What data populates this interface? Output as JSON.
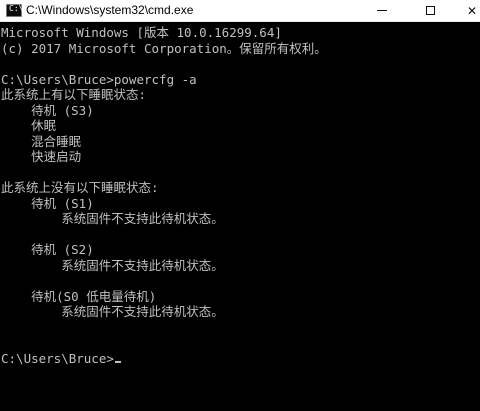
{
  "window": {
    "title": "C:\\Windows\\system32\\cmd.exe",
    "icon": "cmd-icon",
    "buttons": {
      "minimize": "minimize-icon",
      "maximize": "maximize-icon",
      "close": "close-icon"
    }
  },
  "console": {
    "lines": [
      "Microsoft Windows [版本 10.0.16299.64]",
      "(c) 2017 Microsoft Corporation。保留所有权利。",
      "",
      "C:\\Users\\Bruce>powercfg -a",
      "此系统上有以下睡眠状态:",
      "    待机 (S3)",
      "    休眠",
      "    混合睡眠",
      "    快速启动",
      "",
      "此系统上没有以下睡眠状态:",
      "    待机 (S1)",
      "        系统固件不支持此待机状态。",
      "",
      "    待机 (S2)",
      "        系统固件不支持此待机状态。",
      "",
      "    待机(S0 低电量待机)",
      "        系统固件不支持此待机状态。",
      "",
      "",
      "C:\\Users\\Bruce>"
    ]
  }
}
